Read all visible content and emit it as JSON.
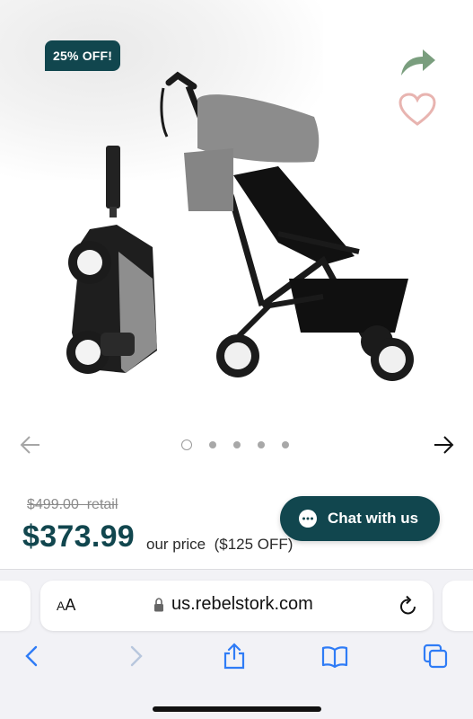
{
  "badge": {
    "text": "25% OFF!"
  },
  "carousel": {
    "slide_count": 5,
    "active_index": 0
  },
  "pricing": {
    "retail": "$499.00  retail",
    "current": "$373.99",
    "label": "our price  ($125 OFF)"
  },
  "chat": {
    "label": "Chat with us"
  },
  "browser": {
    "aa_label_large": "A",
    "aa_label_small": "A",
    "url": "us.rebelstork.com"
  },
  "icons": {
    "share": "share-arrow-icon",
    "favorite": "heart-icon",
    "prev": "arrow-left-icon",
    "next": "arrow-right-icon",
    "chat": "chat-bubble-icon",
    "lock": "lock-icon",
    "reload": "reload-icon",
    "back": "chevron-left-icon",
    "forward": "chevron-right-icon",
    "share_browser": "share-icon",
    "bookmarks": "book-icon",
    "tabs": "tabs-icon"
  },
  "colors": {
    "brand": "#11464e",
    "share_icon": "#7a9e7e",
    "heart_icon": "#e8b4b0",
    "safari_blue": "#2f7cf6"
  }
}
